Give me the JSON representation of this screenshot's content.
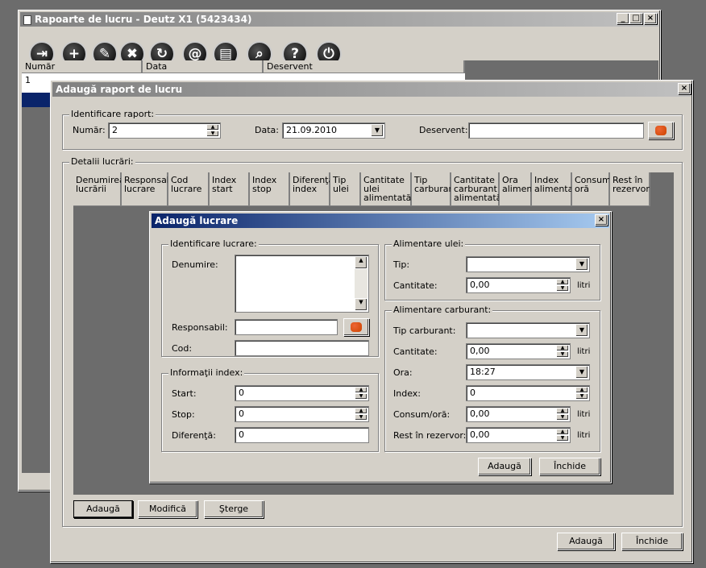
{
  "main_window": {
    "title": "Rapoarte de lucru - Deutz X1 (5423434)",
    "controls": {
      "minimize": "_",
      "maximize": "□",
      "close": "×"
    },
    "toolbar": [
      {
        "icon": "exit-icon",
        "glyph": "⇥"
      },
      {
        "icon": "plus-icon",
        "glyph": "+"
      },
      {
        "icon": "pencil-icon",
        "glyph": "✎"
      },
      {
        "icon": "delete-icon",
        "glyph": "✖"
      },
      {
        "icon": "refresh-icon",
        "glyph": "↻"
      },
      {
        "icon": "at-icon",
        "glyph": "@"
      },
      {
        "icon": "print-icon",
        "glyph": "▤"
      },
      {
        "icon": "search-icon",
        "glyph": "⌕"
      },
      {
        "icon": "help-icon",
        "glyph": "?"
      },
      {
        "icon": "power-icon",
        "glyph": "⏻"
      }
    ],
    "table": {
      "columns": [
        "Număr",
        "Data",
        "Deservent"
      ],
      "rows": [
        [
          "1",
          "",
          ""
        ]
      ]
    }
  },
  "report_dialog": {
    "title": "Adaugă raport de lucru",
    "close": "×",
    "ident_group": "Identificare raport:",
    "numar_label": "Număr:",
    "numar_value": "2",
    "data_label": "Data:",
    "data_value": "21.09.2010",
    "deservent_label": "Deservent:",
    "deservent_value": "",
    "details_group": "Detalii lucrări:",
    "columns": [
      "Denumirea lucrării",
      "Responsabil lucrare",
      "Cod lucrare",
      "Index start",
      "Index stop",
      "Diferenţă index",
      "Tip ulei",
      "Cantitate ulei alimentată",
      "Tip carburant",
      "Cantitate carburant alimentată",
      "Ora alimentare",
      "Index alimentare",
      "Consum/ oră",
      "Rest în rezervor"
    ],
    "btn_adauga": "Adaugă",
    "btn_modifica": "Modifică",
    "btn_sterge": "Şterge",
    "btn_adauga_main": "Adaugă",
    "btn_inchide": "Închide"
  },
  "work_dialog": {
    "title": "Adaugă lucrare",
    "close": "×",
    "ident_group": "Identificare lucrare:",
    "denumire_label": "Denumire:",
    "denumire_value": "",
    "responsabil_label": "Responsabil:",
    "responsabil_value": "",
    "cod_label": "Cod:",
    "cod_value": "",
    "index_group": "Informaţii index:",
    "start_label": "Start:",
    "start_value": "0",
    "stop_label": "Stop:",
    "stop_value": "0",
    "diferenta_label": "Diferenţă:",
    "diferenta_value": "0",
    "oil_group": "Alimentare ulei:",
    "oil_tip_label": "Tip:",
    "oil_tip_value": "",
    "oil_cant_label": "Cantitate:",
    "oil_cant_value": "0,00",
    "oil_unit": "litri",
    "fuel_group": "Alimentare carburant:",
    "fuel_tip_label": "Tip carburant:",
    "fuel_tip_value": "",
    "fuel_cant_label": "Cantitate:",
    "fuel_cant_value": "0,00",
    "fuel_cant_unit": "litri",
    "ora_label": "Ora:",
    "ora_value": "18:27",
    "index_label": "Index:",
    "index_value": "0",
    "consum_label": "Consum/oră:",
    "consum_value": "0,00",
    "consum_unit": "litri",
    "rest_label": "Rest în rezervor:",
    "rest_value": "0,00",
    "rest_unit": "litri",
    "btn_adauga": "Adaugă",
    "btn_inchide": "Închide"
  }
}
